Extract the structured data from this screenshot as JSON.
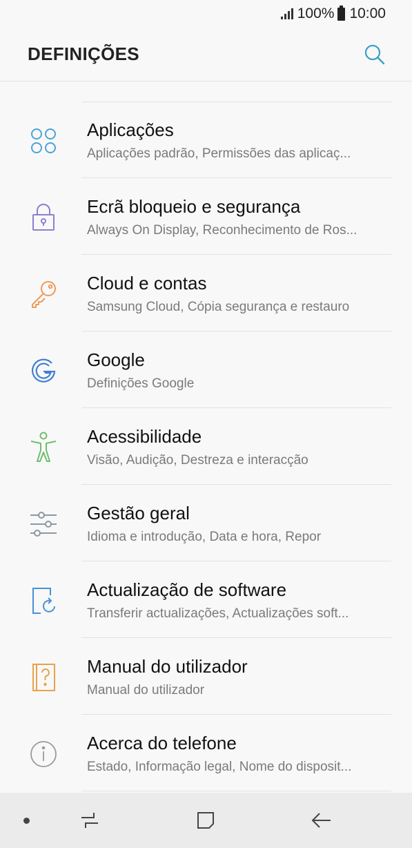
{
  "status_bar": {
    "battery": "100%",
    "time": "10:00"
  },
  "header": {
    "title": "DEFINIÇÕES"
  },
  "items": [
    {
      "title": "Aplicações",
      "subtitle": "Aplicações padrão, Permissões das aplicaç...",
      "icon": "apps-icon",
      "color": "#4aa3d8"
    },
    {
      "title": "Ecrã bloqueio e segurança",
      "subtitle": "Always On Display, Reconhecimento de Ros...",
      "icon": "lock-icon",
      "color": "#8a7fd1"
    },
    {
      "title": "Cloud e contas",
      "subtitle": "Samsung Cloud, Cópia segurança e restauro",
      "icon": "key-icon",
      "color": "#ef9a58"
    },
    {
      "title": "Google",
      "subtitle": "Definições Google",
      "icon": "google-icon",
      "color": "#3f7fcf"
    },
    {
      "title": "Acessibilidade",
      "subtitle": "Visão, Audição, Destreza e interacção",
      "icon": "accessibility-icon",
      "color": "#6dbf6d"
    },
    {
      "title": "Gestão geral",
      "subtitle": "Idioma e introdução, Data e hora, Repor",
      "icon": "sliders-icon",
      "color": "#8d96a0"
    },
    {
      "title": "Actualização de software",
      "subtitle": "Transferir actualizações, Actualizações soft...",
      "icon": "software-update-icon",
      "color": "#4a8fd8"
    },
    {
      "title": "Manual do utilizador",
      "subtitle": "Manual do utilizador",
      "icon": "user-manual-icon",
      "color": "#e8a24a"
    },
    {
      "title": "Acerca do telefone",
      "subtitle": "Estado, Informação legal, Nome do disposit...",
      "icon": "info-icon",
      "color": "#9a9a9a"
    }
  ]
}
